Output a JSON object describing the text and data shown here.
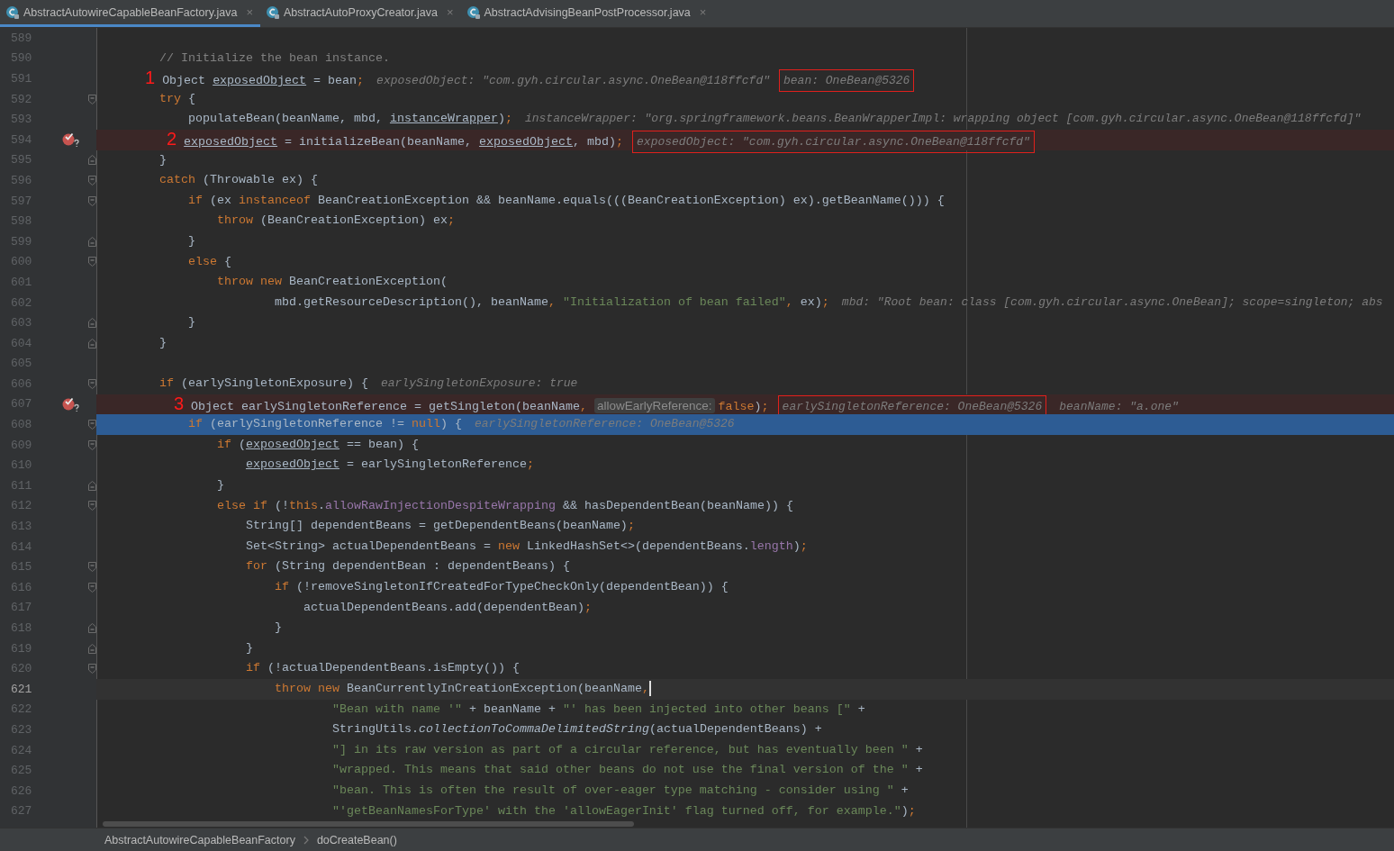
{
  "tabs": [
    {
      "label": "AbstractAutowireCapableBeanFactory.java",
      "close": "×",
      "selected": true
    },
    {
      "label": "AbstractAutoProxyCreator.java",
      "close": "×",
      "selected": false
    },
    {
      "label": "AbstractAdvisingBeanPostProcessor.java",
      "close": "×",
      "selected": false
    }
  ],
  "lines": [
    {
      "number": "589",
      "kind": "plain",
      "fold_start": false,
      "fold_end": false
    },
    {
      "number": "590",
      "kind": "plain",
      "fold_start": false,
      "fold_end": false,
      "tokens": [
        {
          "t": "        // Initialize the bean instance.",
          "kind": "comment"
        }
      ]
    },
    {
      "number": "591",
      "kind": "plain",
      "fold_start": false,
      "fold_end": false,
      "tokens": [
        {
          "t": "      1",
          "kind": "marker"
        },
        {
          "t": " Object ",
          "kind": "plain"
        },
        {
          "t": "exposedObject",
          "kind": "var"
        },
        {
          "t": " = bean",
          "kind": "plain"
        },
        {
          "t": ";",
          "kind": "keyword"
        }
      ],
      "hints": [
        {
          "text": "exposedObject: \"com.gyh.circular.async.OneBean@118ffcfd\"",
          "boxed": false
        },
        {
          "text": "bean: OneBean@5326",
          "boxed": true
        }
      ]
    },
    {
      "number": "592",
      "kind": "plain",
      "fold_start": true,
      "fold_end": false,
      "tokens": [
        {
          "t": "        try",
          "kind": "keyword"
        },
        {
          "t": " {",
          "kind": "plain"
        }
      ]
    },
    {
      "number": "593",
      "kind": "plain",
      "fold_start": false,
      "fold_end": false,
      "tokens": [
        {
          "t": "            populateBean(beanName, mbd, ",
          "kind": "plain"
        },
        {
          "t": "instanceWrapper",
          "kind": "var"
        },
        {
          "t": ")",
          "kind": "plain"
        },
        {
          "t": ";",
          "kind": "keyword"
        }
      ],
      "hints": [
        {
          "text": "instanceWrapper: \"org.springframework.beans.BeanWrapperImpl: wrapping object [com.gyh.circular.async.OneBean@118ffcfd]\"",
          "boxed": false
        }
      ]
    },
    {
      "number": "594",
      "kind": "breakpoint",
      "fold_start": false,
      "fold_end": false,
      "tokens": [
        {
          "t": "         2",
          "kind": "marker"
        },
        {
          "t": " exposedObject",
          "kind": "var"
        },
        {
          "t": " = initializeBean(beanName, ",
          "kind": "plain"
        },
        {
          "t": "exposedObject",
          "kind": "var"
        },
        {
          "t": ", mbd)",
          "kind": "plain"
        },
        {
          "t": ";",
          "kind": "keyword"
        }
      ],
      "hints": [
        {
          "text": "exposedObject: \"com.gyh.circular.async.OneBean@118ffcfd\"",
          "boxed": true
        }
      ]
    },
    {
      "number": "595",
      "kind": "plain",
      "fold_start": false,
      "fold_end": true,
      "tokens": [
        {
          "t": "        }",
          "kind": "plain"
        }
      ]
    },
    {
      "number": "596",
      "kind": "plain",
      "fold_start": true,
      "fold_end": false,
      "tokens": [
        {
          "t": "        catch",
          "kind": "keyword"
        },
        {
          "t": " (Throwable ex) {",
          "kind": "plain"
        }
      ]
    },
    {
      "number": "597",
      "kind": "plain",
      "fold_start": true,
      "fold_end": false,
      "tokens": [
        {
          "t": "            if",
          "kind": "keyword"
        },
        {
          "t": " (ex ",
          "kind": "plain"
        },
        {
          "t": "instanceof",
          "kind": "keyword"
        },
        {
          "t": " BeanCreationException && beanName.equals(((BeanCreationException) ex).getBeanName())) {",
          "kind": "plain"
        }
      ]
    },
    {
      "number": "598",
      "kind": "plain",
      "fold_start": false,
      "fold_end": false,
      "tokens": [
        {
          "t": "                throw",
          "kind": "keyword"
        },
        {
          "t": " (BeanCreationException) ex",
          "kind": "plain"
        },
        {
          "t": ";",
          "kind": "keyword"
        }
      ]
    },
    {
      "number": "599",
      "kind": "plain",
      "fold_start": false,
      "fold_end": true,
      "tokens": [
        {
          "t": "            }",
          "kind": "plain"
        }
      ]
    },
    {
      "number": "600",
      "kind": "plain",
      "fold_start": true,
      "fold_end": false,
      "tokens": [
        {
          "t": "            else",
          "kind": "keyword"
        },
        {
          "t": " {",
          "kind": "plain"
        }
      ]
    },
    {
      "number": "601",
      "kind": "plain",
      "fold_start": false,
      "fold_end": false,
      "tokens": [
        {
          "t": "                throw new",
          "kind": "keyword"
        },
        {
          "t": " BeanCreationException(",
          "kind": "plain"
        }
      ]
    },
    {
      "number": "602",
      "kind": "plain",
      "fold_start": false,
      "fold_end": false,
      "tokens": [
        {
          "t": "                        mbd.getResourceDescription(), beanName",
          "kind": "plain"
        },
        {
          "t": ",",
          "kind": "keyword"
        },
        {
          "t": " \"Initialization of bean failed\"",
          "kind": "string"
        },
        {
          "t": ",",
          "kind": "keyword"
        },
        {
          "t": " ex)",
          "kind": "plain"
        },
        {
          "t": ";",
          "kind": "keyword"
        }
      ],
      "hints": [
        {
          "text": "mbd: \"Root bean: class [com.gyh.circular.async.OneBean]; scope=singleton; abs",
          "boxed": false
        }
      ]
    },
    {
      "number": "603",
      "kind": "plain",
      "fold_start": false,
      "fold_end": true,
      "tokens": [
        {
          "t": "            }",
          "kind": "plain"
        }
      ]
    },
    {
      "number": "604",
      "kind": "plain",
      "fold_start": false,
      "fold_end": true,
      "tokens": [
        {
          "t": "        }",
          "kind": "plain"
        }
      ]
    },
    {
      "number": "605",
      "kind": "plain",
      "fold_start": false,
      "fold_end": false
    },
    {
      "number": "606",
      "kind": "plain",
      "fold_start": true,
      "fold_end": false,
      "tokens": [
        {
          "t": "        if",
          "kind": "keyword"
        },
        {
          "t": " (earlySingletonExposure) {",
          "kind": "plain"
        }
      ],
      "hints": [
        {
          "text": "earlySingletonExposure: true",
          "boxed": false
        }
      ]
    },
    {
      "number": "607",
      "kind": "breakpoint",
      "fold_start": false,
      "fold_end": false,
      "tokens": [
        {
          "t": "          3",
          "kind": "marker"
        },
        {
          "t": " Object earlySingletonReference = getSingleton(beanName",
          "kind": "plain"
        },
        {
          "t": ",",
          "kind": "keyword"
        },
        {
          "t": "allowEarlyReference:",
          "kind": "param"
        },
        {
          "t": "false",
          "kind": "keyword"
        },
        {
          "t": ")",
          "kind": "plain"
        },
        {
          "t": ";",
          "kind": "keyword"
        }
      ],
      "hints": [
        {
          "text": "earlySingletonReference: OneBean@5326",
          "boxed": true
        },
        {
          "text": "beanName: \"a.one\"",
          "boxed": false
        }
      ]
    },
    {
      "number": "608",
      "kind": "execution",
      "fold_start": true,
      "fold_end": false,
      "tokens": [
        {
          "t": "            if",
          "kind": "keyword"
        },
        {
          "t": " (earlySingletonReference != ",
          "kind": "plain"
        },
        {
          "t": "null",
          "kind": "keyword"
        },
        {
          "t": ") {",
          "kind": "plain"
        }
      ],
      "hints": [
        {
          "text": "earlySingletonReference: OneBean@5326",
          "boxed": false
        }
      ]
    },
    {
      "number": "609",
      "kind": "plain",
      "fold_start": true,
      "fold_end": false,
      "tokens": [
        {
          "t": "                if",
          "kind": "keyword"
        },
        {
          "t": " (",
          "kind": "plain"
        },
        {
          "t": "exposedObject",
          "kind": "var"
        },
        {
          "t": " == bean) {",
          "kind": "plain"
        }
      ]
    },
    {
      "number": "610",
      "kind": "plain",
      "fold_start": false,
      "fold_end": false,
      "tokens": [
        {
          "t": "                    exposedObject",
          "kind": "var"
        },
        {
          "t": " = earlySingletonReference",
          "kind": "plain"
        },
        {
          "t": ";",
          "kind": "keyword"
        }
      ]
    },
    {
      "number": "611",
      "kind": "plain",
      "fold_start": false,
      "fold_end": true,
      "tokens": [
        {
          "t": "                }",
          "kind": "plain"
        }
      ]
    },
    {
      "number": "612",
      "kind": "plain",
      "fold_start": true,
      "fold_end": false,
      "tokens": [
        {
          "t": "                else if",
          "kind": "keyword"
        },
        {
          "t": " (!",
          "kind": "plain"
        },
        {
          "t": "this",
          "kind": "keyword"
        },
        {
          "t": ".",
          "kind": "plain"
        },
        {
          "t": "allowRawInjectionDespiteWrapping",
          "kind": "field"
        },
        {
          "t": " && hasDependentBean(beanName)) {",
          "kind": "plain"
        }
      ]
    },
    {
      "number": "613",
      "kind": "plain",
      "fold_start": false,
      "fold_end": false,
      "tokens": [
        {
          "t": "                    String[] dependentBeans = getDependentBeans(beanName)",
          "kind": "plain"
        },
        {
          "t": ";",
          "kind": "keyword"
        }
      ]
    },
    {
      "number": "614",
      "kind": "plain",
      "fold_start": false,
      "fold_end": false,
      "tokens": [
        {
          "t": "                    Set<String> actualDependentBeans = ",
          "kind": "plain"
        },
        {
          "t": "new",
          "kind": "keyword"
        },
        {
          "t": " LinkedHashSet<>(dependentBeans.",
          "kind": "plain"
        },
        {
          "t": "length",
          "kind": "field"
        },
        {
          "t": ")",
          "kind": "plain"
        },
        {
          "t": ";",
          "kind": "keyword"
        }
      ]
    },
    {
      "number": "615",
      "kind": "plain",
      "fold_start": true,
      "fold_end": false,
      "tokens": [
        {
          "t": "                    for",
          "kind": "keyword"
        },
        {
          "t": " (String dependentBean : dependentBeans) {",
          "kind": "plain"
        }
      ]
    },
    {
      "number": "616",
      "kind": "plain",
      "fold_start": true,
      "fold_end": false,
      "tokens": [
        {
          "t": "                        if",
          "kind": "keyword"
        },
        {
          "t": " (!removeSingletonIfCreatedForTypeCheckOnly(dependentBean)) {",
          "kind": "plain"
        }
      ]
    },
    {
      "number": "617",
      "kind": "plain",
      "fold_start": false,
      "fold_end": false,
      "tokens": [
        {
          "t": "                            actualDependentBeans.add(dependentBean)",
          "kind": "plain"
        },
        {
          "t": ";",
          "kind": "keyword"
        }
      ]
    },
    {
      "number": "618",
      "kind": "plain",
      "fold_start": false,
      "fold_end": true,
      "tokens": [
        {
          "t": "                        }",
          "kind": "plain"
        }
      ]
    },
    {
      "number": "619",
      "kind": "plain",
      "fold_start": false,
      "fold_end": true,
      "tokens": [
        {
          "t": "                    }",
          "kind": "plain"
        }
      ]
    },
    {
      "number": "620",
      "kind": "plain",
      "fold_start": true,
      "fold_end": false,
      "tokens": [
        {
          "t": "                    if",
          "kind": "keyword"
        },
        {
          "t": " (!actualDependentBeans.isEmpty()) {",
          "kind": "plain"
        }
      ]
    },
    {
      "number": "621",
      "kind": "caret",
      "fold_start": false,
      "fold_end": false,
      "tokens": [
        {
          "t": "                        throw new",
          "kind": "keyword"
        },
        {
          "t": " BeanCurrentlyInCreationException(beanName",
          "kind": "plain"
        },
        {
          "t": ",",
          "kind": "keyword"
        }
      ]
    },
    {
      "number": "622",
      "kind": "plain",
      "fold_start": false,
      "fold_end": false,
      "tokens": [
        {
          "t": "                                \"Bean with name '\"",
          "kind": "string"
        },
        {
          "t": " + beanName + ",
          "kind": "plain"
        },
        {
          "t": "\"' has been injected into other beans [\"",
          "kind": "string"
        },
        {
          "t": " +",
          "kind": "plain"
        }
      ]
    },
    {
      "number": "623",
      "kind": "plain",
      "fold_start": false,
      "fold_end": false,
      "tokens": [
        {
          "t": "                                StringUtils.",
          "kind": "plain"
        },
        {
          "t": "collectionToCommaDelimitedString",
          "kind": "static"
        },
        {
          "t": "(actualDependentBeans) +",
          "kind": "plain"
        }
      ]
    },
    {
      "number": "624",
      "kind": "plain",
      "fold_start": false,
      "fold_end": false,
      "tokens": [
        {
          "t": "                                \"] in its raw version as part of a circular reference, but has eventually been \"",
          "kind": "string"
        },
        {
          "t": " +",
          "kind": "plain"
        }
      ]
    },
    {
      "number": "625",
      "kind": "plain",
      "fold_start": false,
      "fold_end": false,
      "tokens": [
        {
          "t": "                                \"wrapped. This means that said other beans do not use the final version of the \"",
          "kind": "string"
        },
        {
          "t": " +",
          "kind": "plain"
        }
      ]
    },
    {
      "number": "626",
      "kind": "plain",
      "fold_start": false,
      "fold_end": false,
      "tokens": [
        {
          "t": "                                \"bean. This is often the result of over-eager type matching - consider using \"",
          "kind": "string"
        },
        {
          "t": " +",
          "kind": "plain"
        }
      ]
    },
    {
      "number": "627",
      "kind": "plain",
      "fold_start": false,
      "fold_end": false,
      "tokens": [
        {
          "t": "                                \"'getBeanNamesForType' with the 'allowEagerInit' flag turned off, for example.\"",
          "kind": "string"
        },
        {
          "t": ")",
          "kind": "plain"
        },
        {
          "t": ";",
          "kind": "keyword"
        }
      ]
    }
  ],
  "breadcrumb": [
    "AbstractAutowireCapableBeanFactory",
    "doCreateBean()"
  ]
}
